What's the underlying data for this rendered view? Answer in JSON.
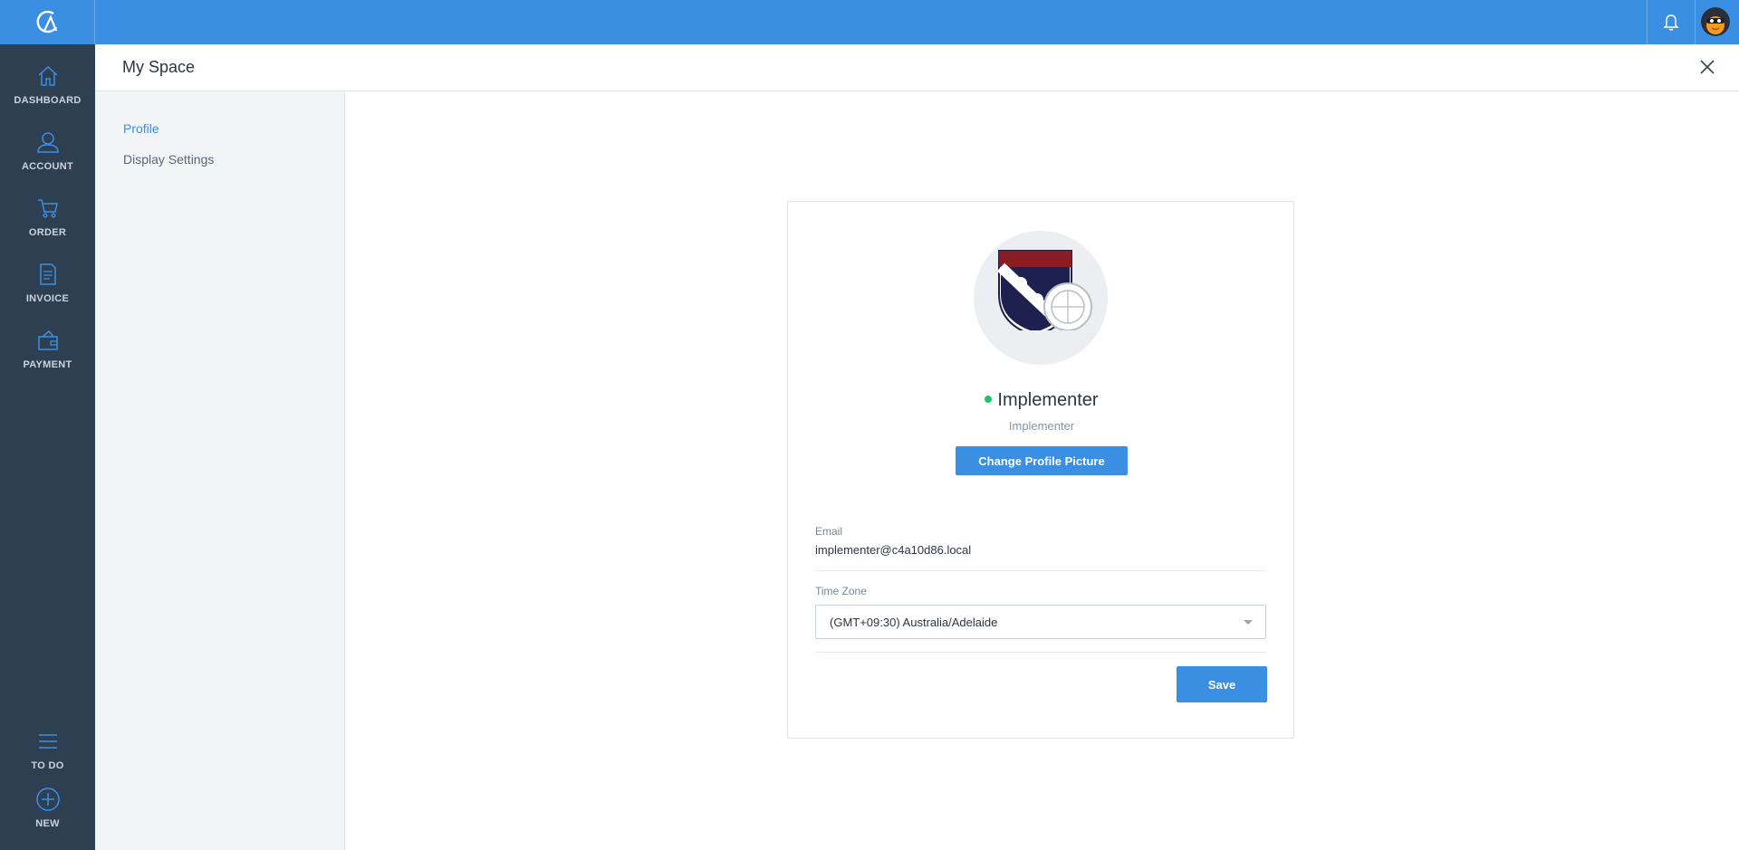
{
  "app": {
    "title": "My Space",
    "accent_color": "#3b8fe3",
    "nav_bg_color": "#2f3f52",
    "online_color": "#1fc46a"
  },
  "topbar": {
    "logo_icon": "app-logo-icon",
    "notification_icon": "bell-icon",
    "avatar_icon": "user-avatar"
  },
  "nav": {
    "items": [
      {
        "label": "DASHBOARD",
        "icon": "home-icon"
      },
      {
        "label": "ACCOUNT",
        "icon": "user-icon"
      },
      {
        "label": "ORDER",
        "icon": "cart-icon"
      },
      {
        "label": "INVOICE",
        "icon": "document-icon"
      },
      {
        "label": "PAYMENT",
        "icon": "wallet-icon"
      }
    ],
    "bottom": [
      {
        "label": "TO DO",
        "icon": "list-icon"
      },
      {
        "label": "NEW",
        "icon": "plus-circle-icon"
      }
    ]
  },
  "sidebar": {
    "items": [
      {
        "label": "Profile",
        "active": true
      },
      {
        "label": "Display Settings",
        "active": false
      }
    ]
  },
  "profile": {
    "name": "Implementer",
    "role": "Implementer",
    "status": "online",
    "change_picture_label": "Change Profile Picture",
    "email_label": "Email",
    "email_value": "implementer@c4a10d86.local",
    "timezone_label": "Time Zone",
    "timezone_value": "(GMT+09:30) Australia/Adelaide",
    "save_label": "Save"
  }
}
